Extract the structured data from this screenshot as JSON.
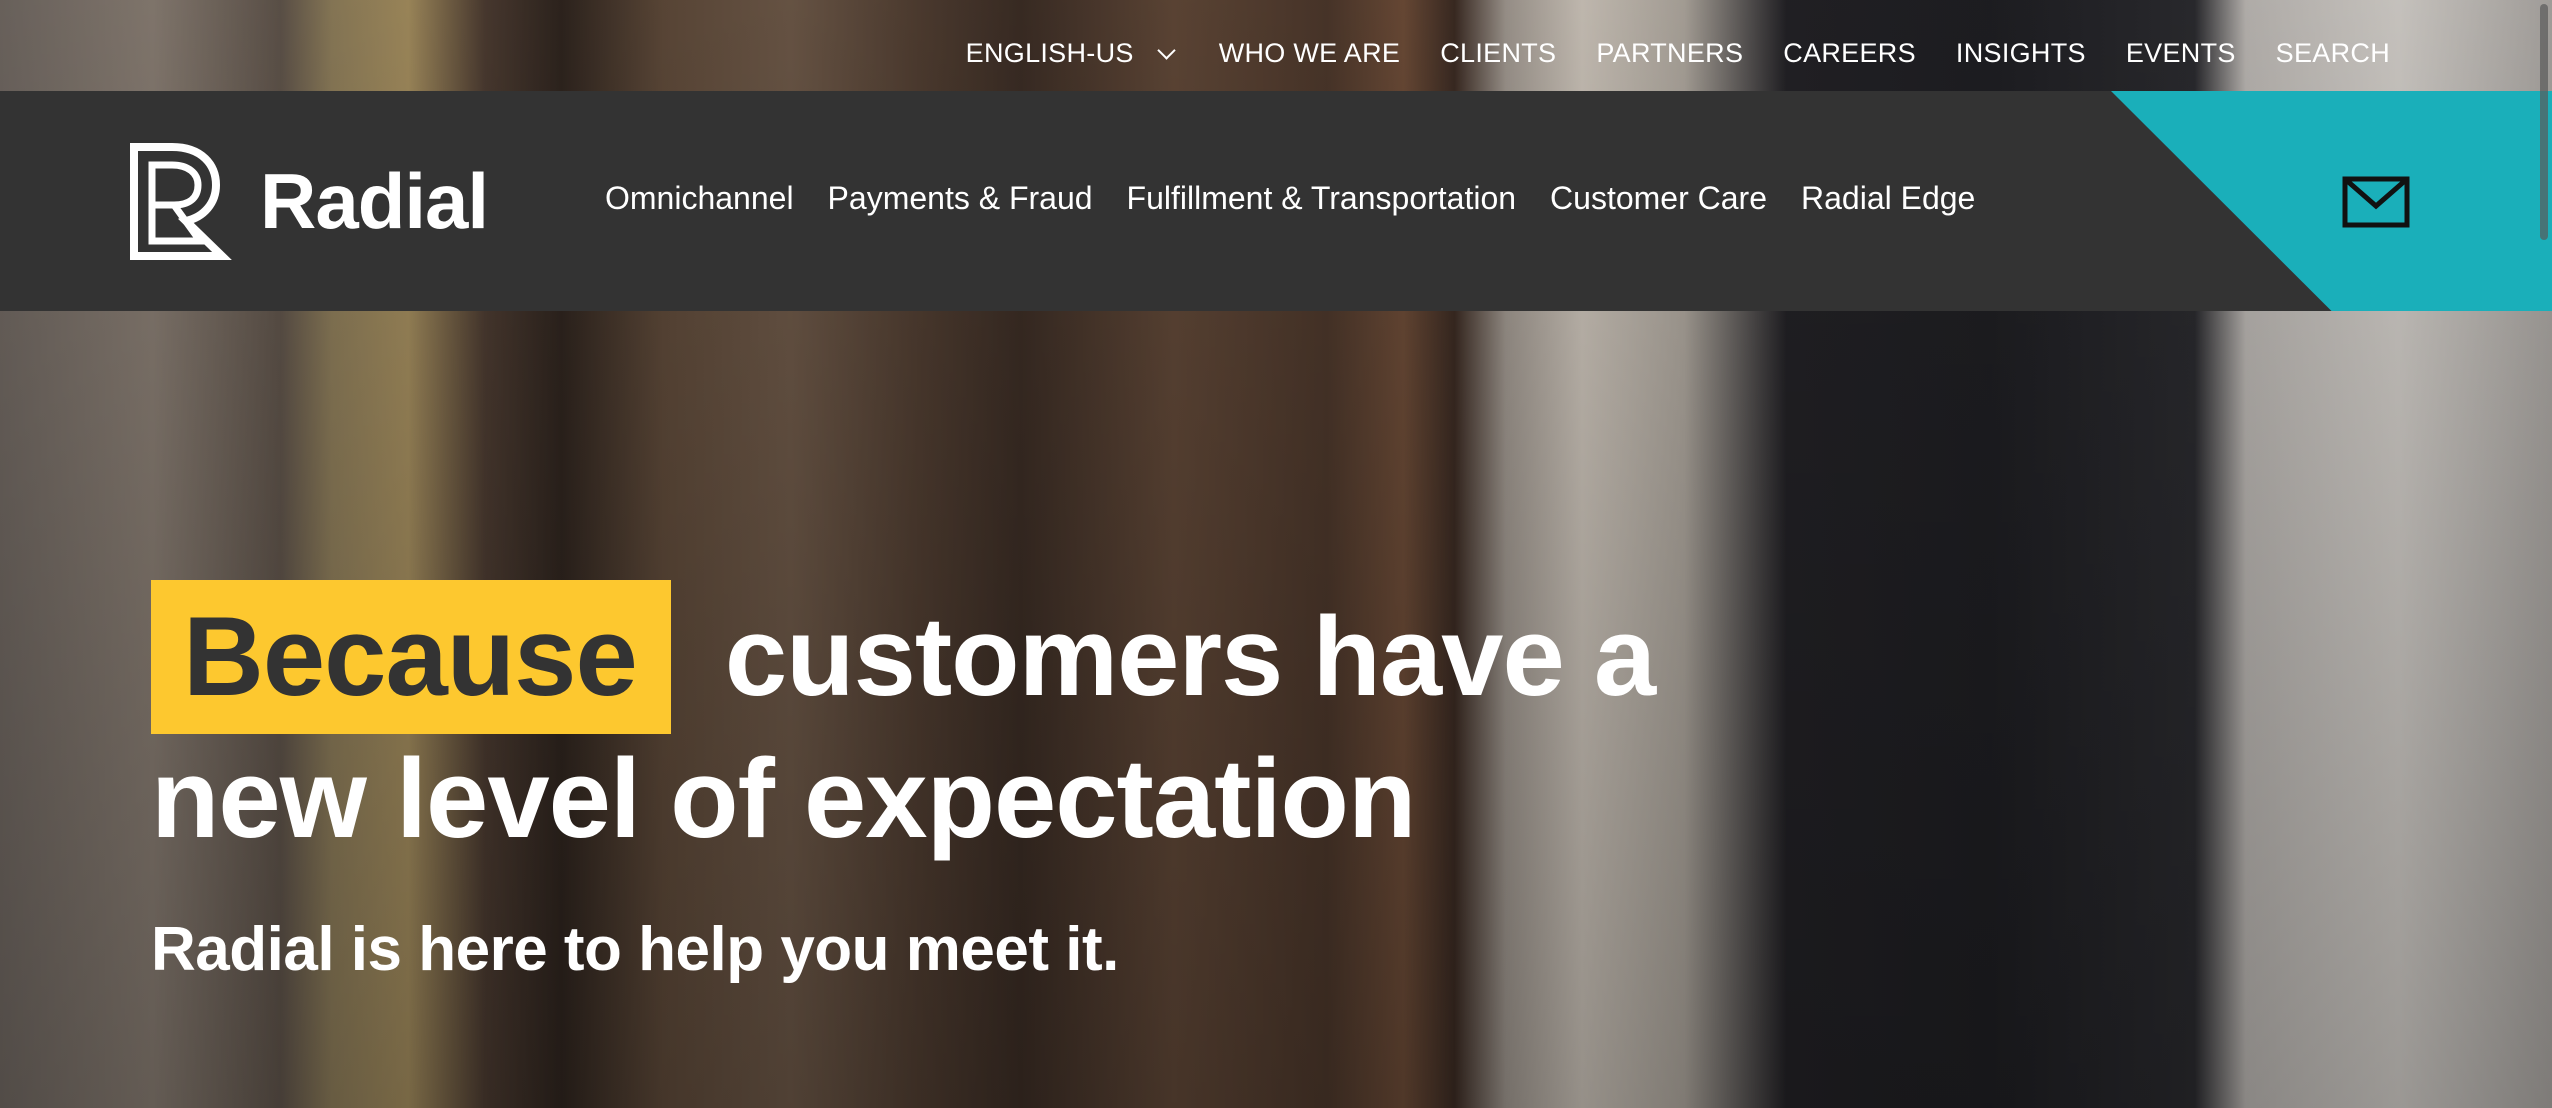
{
  "top_nav": {
    "language": "ENGLISH-US",
    "items": [
      "WHO WE ARE",
      "CLIENTS",
      "PARTNERS",
      "CAREERS",
      "INSIGHTS",
      "EVENTS",
      "SEARCH"
    ]
  },
  "brand": {
    "name": "Radial"
  },
  "main_nav": [
    "Omnichannel",
    "Payments & Fraud",
    "Fulfillment & Transportation",
    "Customer Care",
    "Radial Edge"
  ],
  "hero": {
    "highlight": "Because",
    "headline_rest_1": "customers have a",
    "headline_line_2": "new level of expectation",
    "subheadline": "Radial is here to help you meet it."
  },
  "colors": {
    "bar": "#333333",
    "accent_teal": "#1aafba",
    "highlight_yellow": "#fdc82f"
  }
}
